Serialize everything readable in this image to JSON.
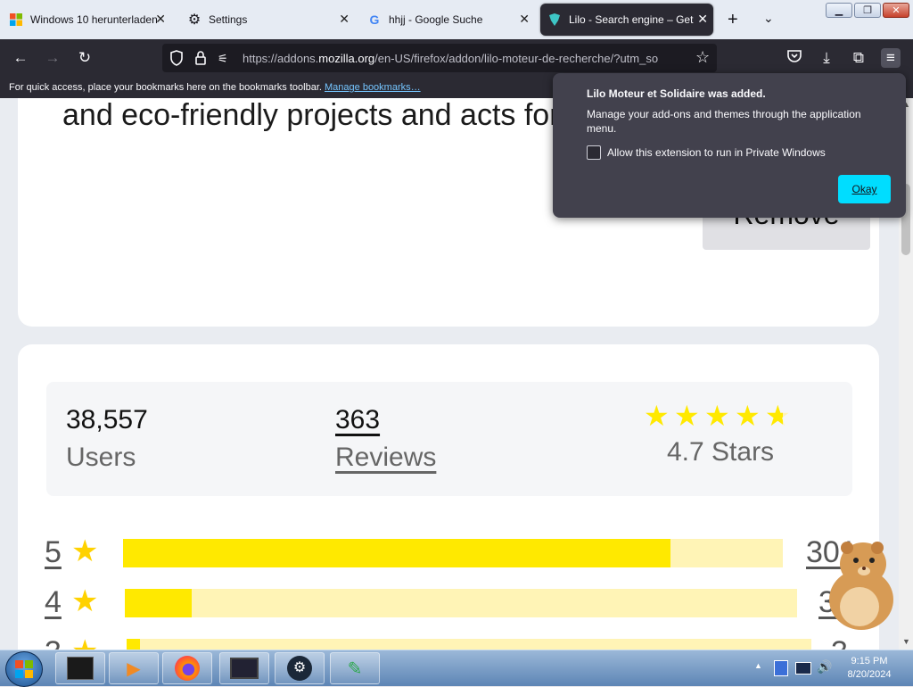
{
  "tabs": [
    {
      "title": "Windows 10 herunterladen",
      "icon": "windows-logo-icon"
    },
    {
      "title": "Settings",
      "icon": "gear-icon"
    },
    {
      "title": "hhjj - Google Suche",
      "icon": "google-logo-icon"
    },
    {
      "title": "Lilo - Search engine – Get",
      "icon": "lilo-logo-icon",
      "active": true
    }
  ],
  "navbar": {
    "url_prefix": "https://addons.",
    "url_domain": "mozilla.org",
    "url_suffix": "/en-US/firefox/addon/lilo-moteur-de-recherche/?utm_so"
  },
  "bookmarks_bar": {
    "text": "For quick access, place your bookmarks here on the bookmarks toolbar.",
    "link": "Manage bookmarks…"
  },
  "page": {
    "description": "and eco-friendly projects and acts for",
    "remove_button": "Remove",
    "stats": {
      "users_count": "38,557",
      "users_label": "Users",
      "reviews_count": "363",
      "reviews_label": "Reviews",
      "rating_label": "4.7 Stars",
      "rating_value": 4.7
    },
    "rating_rows": [
      {
        "stars": "5",
        "fraction": 0.83,
        "count": "301"
      },
      {
        "stars": "4",
        "fraction": 0.1,
        "count": "30"
      },
      {
        "stars": "3",
        "fraction": 0.02,
        "count": "3"
      }
    ]
  },
  "popup": {
    "title": "Lilo Moteur et Solidaire was added.",
    "body": "Manage your add-ons and themes through the application menu.",
    "checkbox_label": "Allow this extension to run in Private Windows",
    "okay_button": "Okay"
  },
  "taskbar": {
    "time": "9:15 PM",
    "date": "8/20/2024"
  },
  "colors": {
    "accent": "#00ddff",
    "star": "#ffe900",
    "bar_bg": "#fff4b6",
    "dark_toolbar": "#2b2a33"
  }
}
